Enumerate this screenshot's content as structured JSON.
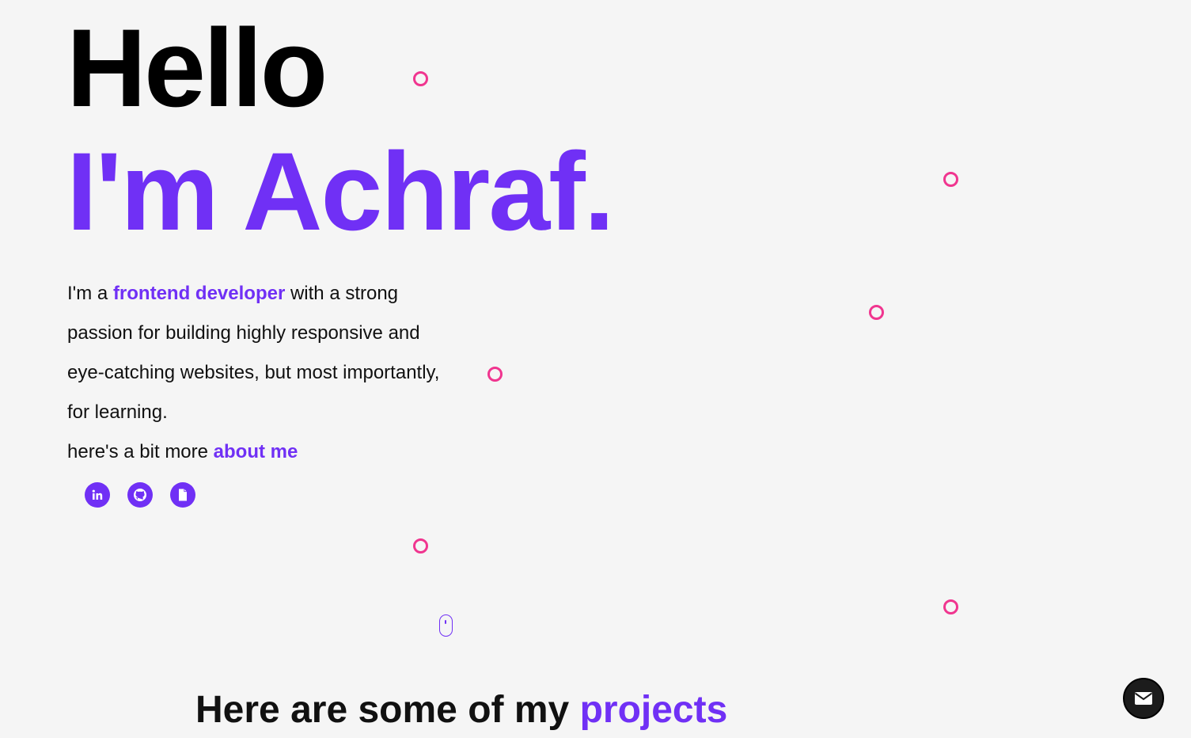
{
  "hero": {
    "greeting": "Hello",
    "name_line": "I'm Achraf."
  },
  "intro": {
    "line1_pre": "I'm a ",
    "line1_accent": "frontend developer",
    "line1_post": " with a strong",
    "line2": "passion for building highly responsive and",
    "line3": "eye-catching websites, but most importantly,",
    "line4": "for learning.",
    "more_pre": "here's a bit more ",
    "more_link": "about me"
  },
  "social": [
    {
      "icon": "linkedin-icon"
    },
    {
      "icon": "github-icon"
    },
    {
      "icon": "document-icon"
    }
  ],
  "projects": {
    "title_pre": "Here are some of my ",
    "title_accent": "projects"
  },
  "contact": {
    "icon": "envelope-icon"
  },
  "colors": {
    "accent": "#7030f5",
    "ring": "#f0358f",
    "background": "#f5f5f5",
    "fab": "#1c1c1c"
  }
}
